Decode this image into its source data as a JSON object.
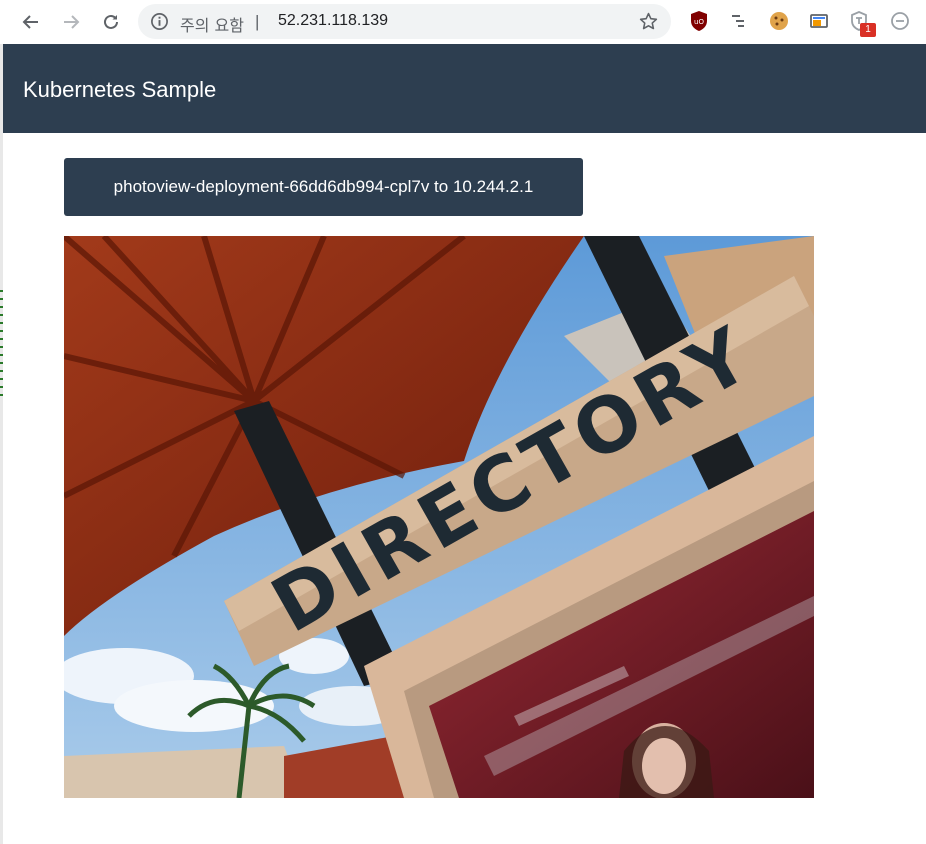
{
  "browser": {
    "security_warning": "주의 요함",
    "separator": "|",
    "url": "52.231.118.139",
    "extension_badge_count": "1",
    "icons": [
      "back-arrow-icon",
      "forward-arrow-icon",
      "reload-icon",
      "info-icon",
      "star-icon",
      "ublock-icon",
      "tree-extension-icon",
      "cookie-icon",
      "cast-window-icon",
      "shield-extension-icon",
      "minus-circle-icon"
    ]
  },
  "app": {
    "title": "Kubernetes Sample",
    "host_info": "photoview-deployment-66dd6db994-cpl7v to 10.244.2.1"
  },
  "photo": {
    "sign_text": "DIRECTORY",
    "colors": {
      "sky": "#6fa7dd",
      "canopy": "#8e2a12",
      "sign": "#c8a889",
      "letters": "#1e2a33",
      "poles": "#1b1f23",
      "frame": "#d9b79a",
      "glass": "#7a1e2a"
    }
  },
  "colors": {
    "header_bg": "#2d3e50",
    "header_text": "#ffffff"
  }
}
